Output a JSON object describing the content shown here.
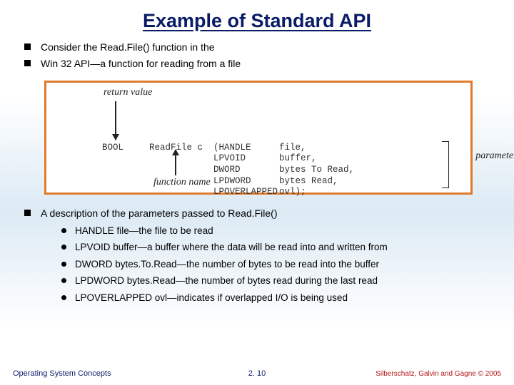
{
  "title": "Example of Standard API",
  "bullets_top": [
    "Consider the Read.File() function in the",
    "Win 32 API—a function for reading from a file"
  ],
  "figure": {
    "return_value_label": "return value",
    "function_name_label": "function name",
    "parameters_label": "parameters",
    "ret_type": "BOOL",
    "fn_name": "ReadFile c",
    "params": [
      {
        "type": "(HANDLE",
        "name": "file,"
      },
      {
        "type": "LPVOID",
        "name": "buffer,"
      },
      {
        "type": "DWORD",
        "name": "bytes To Read,"
      },
      {
        "type": "LPDWORD",
        "name": "bytes Read,"
      },
      {
        "type": "LPOVERLAPPED",
        "name": "ovl);"
      }
    ]
  },
  "desc_heading": "A description of the parameters passed to Read.File()",
  "sub_bullets": [
    "HANDLE file—the file to be read",
    "LPVOID buffer—a buffer where the data will be read into and written from",
    "DWORD bytes.To.Read—the number of bytes to be read into the buffer",
    "LPDWORD bytes.Read—the number of bytes read during the last read",
    "LPOVERLAPPED ovl—indicates if overlapped I/O is being used"
  ],
  "footer": {
    "left": "Operating System Concepts",
    "center": "2. 10",
    "right": "Silberschatz, Galvin and Gagne © 2005"
  }
}
